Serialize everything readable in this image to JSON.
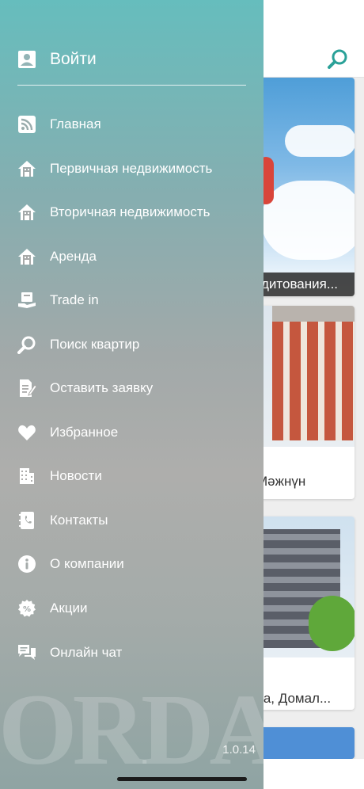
{
  "drawer": {
    "login_label": "Войти",
    "version": "1.0.14",
    "watermark": "ORDA",
    "items": [
      {
        "label": "Главная",
        "icon": "rss-icon"
      },
      {
        "label": "Первичная недвижимость",
        "icon": "house-icon"
      },
      {
        "label": "Вторичная недвижимость",
        "icon": "house-icon"
      },
      {
        "label": "Аренда",
        "icon": "house-icon"
      },
      {
        "label": "Trade in",
        "icon": "trade-in-icon"
      },
      {
        "label": "Поиск квартир",
        "icon": "search-icon"
      },
      {
        "label": "Оставить заявку",
        "icon": "edit-document-icon"
      },
      {
        "label": "Избранное",
        "icon": "heart-icon"
      },
      {
        "label": "Новости",
        "icon": "building-icon"
      },
      {
        "label": "Контакты",
        "icon": "contact-book-icon"
      },
      {
        "label": "О компании",
        "icon": "info-icon"
      },
      {
        "label": "Акции",
        "icon": "percent-badge-icon"
      },
      {
        "label": "Онлайн чат",
        "icon": "chat-icon"
      }
    ]
  },
  "feed": {
    "cards": [
      {
        "title": "дитования..."
      },
      {
        "title": "Мәжнүн"
      },
      {
        "title": "ва, Домал..."
      }
    ]
  },
  "colors": {
    "accent": "#2aa198",
    "drawer_top": "#66bdbd",
    "drawer_bottom": "#8fa4a3"
  }
}
